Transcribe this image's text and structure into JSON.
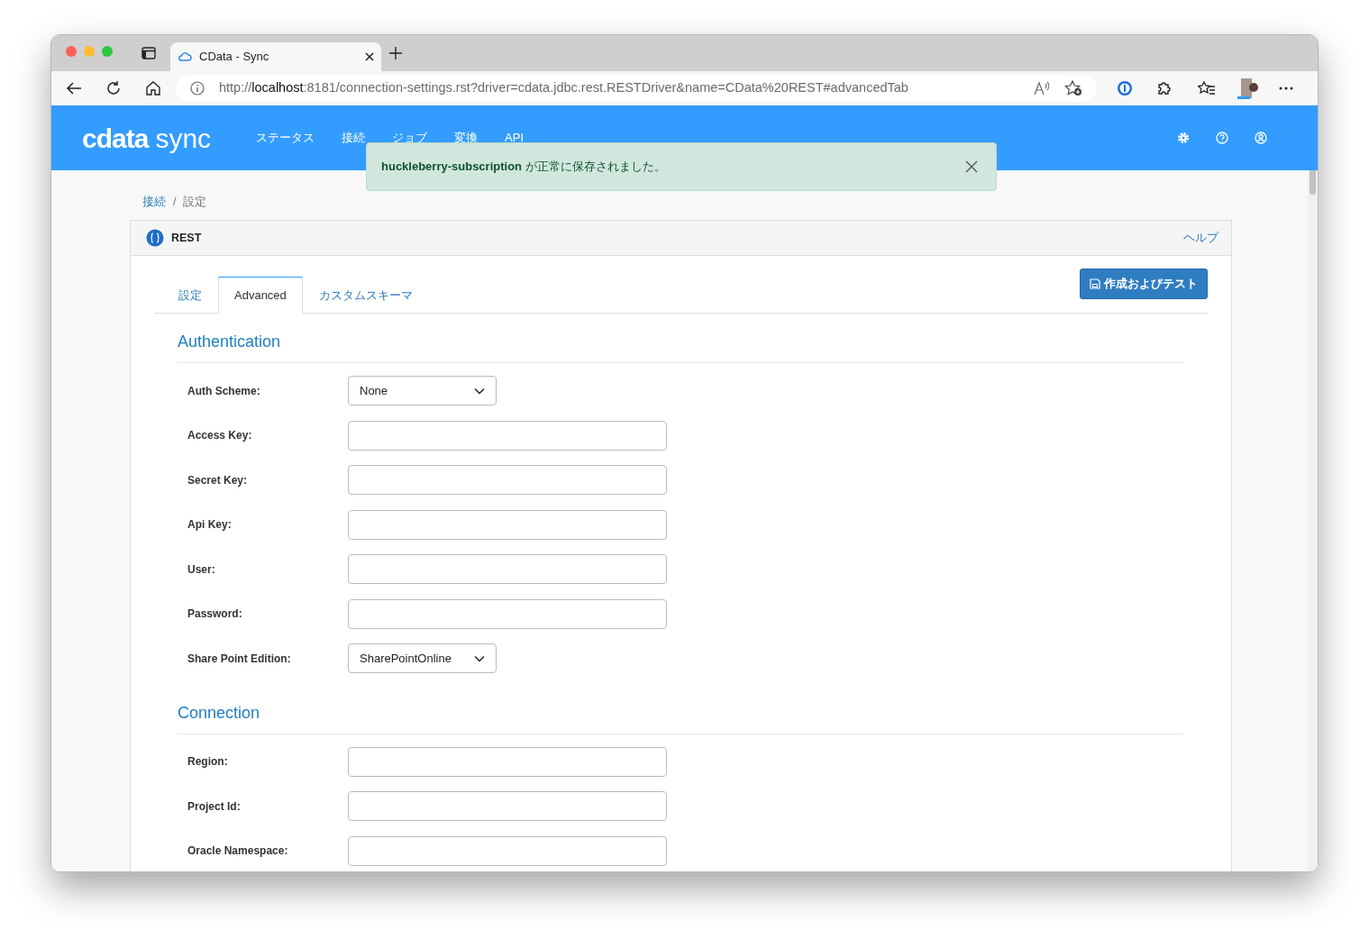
{
  "browser": {
    "tab_title": "CData - Sync",
    "url": "http://**localhost**:8181/connection-settings.rst?driver=cdata.jdbc.rest.RESTDriver&name=CData%20REST#advancedTab"
  },
  "app": {
    "logo_main": "cdata",
    "logo_sub": "sync",
    "nav": [
      {
        "label": "ステータス"
      },
      {
        "label": "接続"
      },
      {
        "label": "ジョブ"
      },
      {
        "label": "変換"
      },
      {
        "label": "API"
      }
    ]
  },
  "toast": {
    "message": "**huckleberry-subscription** が正常に保存されました。"
  },
  "breadcrumb": {
    "separator": "/",
    "items": [
      {
        "label": "接続",
        "link": true
      },
      {
        "label": "設定",
        "link": false
      }
    ]
  },
  "card": {
    "title": "REST",
    "help": "ヘルプ",
    "action": "作成およびテスト",
    "tabs": [
      {
        "label": "設定",
        "selected": false
      },
      {
        "label": "Advanced",
        "selected": true
      },
      {
        "label": "カスタムスキーマ",
        "selected": false
      }
    ],
    "sections": [
      {
        "title": "Authentication",
        "fields": [
          {
            "label": "Auth Scheme:",
            "kind": "select",
            "value": "None"
          },
          {
            "label": "Access Key:",
            "kind": "text"
          },
          {
            "label": "Secret Key:",
            "kind": "text"
          },
          {
            "label": "Api Key:",
            "kind": "text"
          },
          {
            "label": "User:",
            "kind": "text"
          },
          {
            "label": "Password:",
            "kind": "text"
          },
          {
            "label": "Share Point Edition:",
            "kind": "select",
            "value": "SharePointOnline"
          }
        ]
      },
      {
        "title": "Connection",
        "fields": [
          {
            "label": "Region:",
            "kind": "text"
          },
          {
            "label": "Project Id:",
            "kind": "text"
          },
          {
            "label": "Oracle Namespace:",
            "kind": "text"
          }
        ]
      }
    ]
  }
}
